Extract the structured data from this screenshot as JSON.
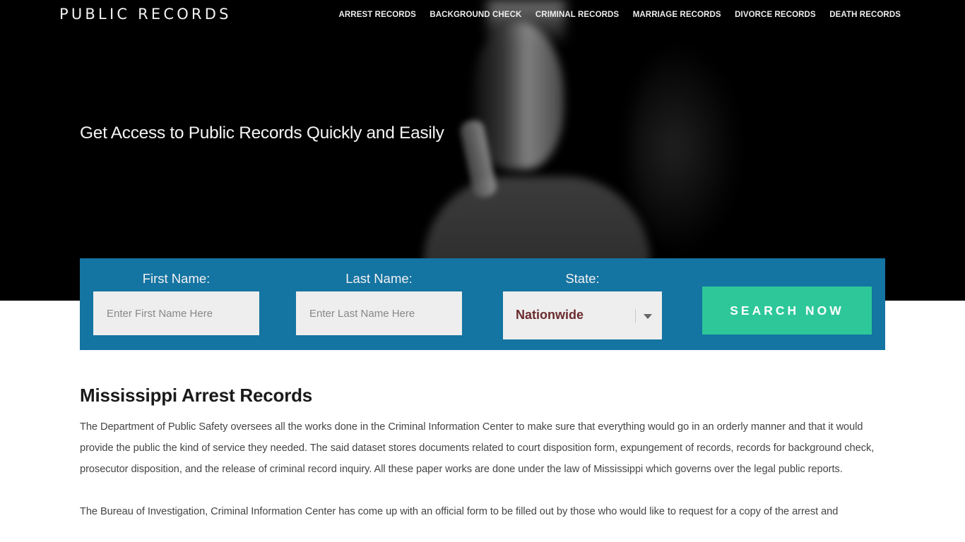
{
  "header": {
    "logo": "PUBLIC RECORDS",
    "nav": [
      {
        "label": "ARREST RECORDS"
      },
      {
        "label": "BACKGROUND CHECK"
      },
      {
        "label": "CRIMINAL RECORDS"
      },
      {
        "label": "MARRIAGE RECORDS"
      },
      {
        "label": "DIVORCE RECORDS"
      },
      {
        "label": "DEATH RECORDS"
      }
    ]
  },
  "hero": {
    "tagline": "Get Access to Public Records Quickly and Easily",
    "image": "hooded-man-silence-gesture-photo"
  },
  "search": {
    "first_name_label": "First Name:",
    "first_name_placeholder": "Enter First Name Here",
    "first_name_value": "",
    "last_name_label": "Last Name:",
    "last_name_placeholder": "Enter Last Name Here",
    "last_name_value": "",
    "state_label": "State:",
    "state_value": "Nationwide",
    "state_icon": "chevron-down-icon",
    "button_label": "SEARCH NOW"
  },
  "colors": {
    "panel": "#1474a2",
    "button": "#2ec799",
    "select_text": "#6b2b2e",
    "hero_bg": "#000000"
  },
  "article": {
    "title": "Mississippi Arrest Records",
    "paragraphs": [
      "The Department of Public Safety oversees all the works done in the Criminal Information Center to make sure that everything would go in an orderly manner and that it would provide the public the kind of service they needed. The said dataset stores documents related to court disposition form, expungement of records, records for background check, prosecutor disposition, and the release of criminal record inquiry. All these paper works are done under the law of Mississippi which governs over the legal public reports.",
      "The Bureau of Investigation, Criminal Information Center has come up with an official form to be filled out by those who would like to request for a copy of the arrest and"
    ]
  }
}
